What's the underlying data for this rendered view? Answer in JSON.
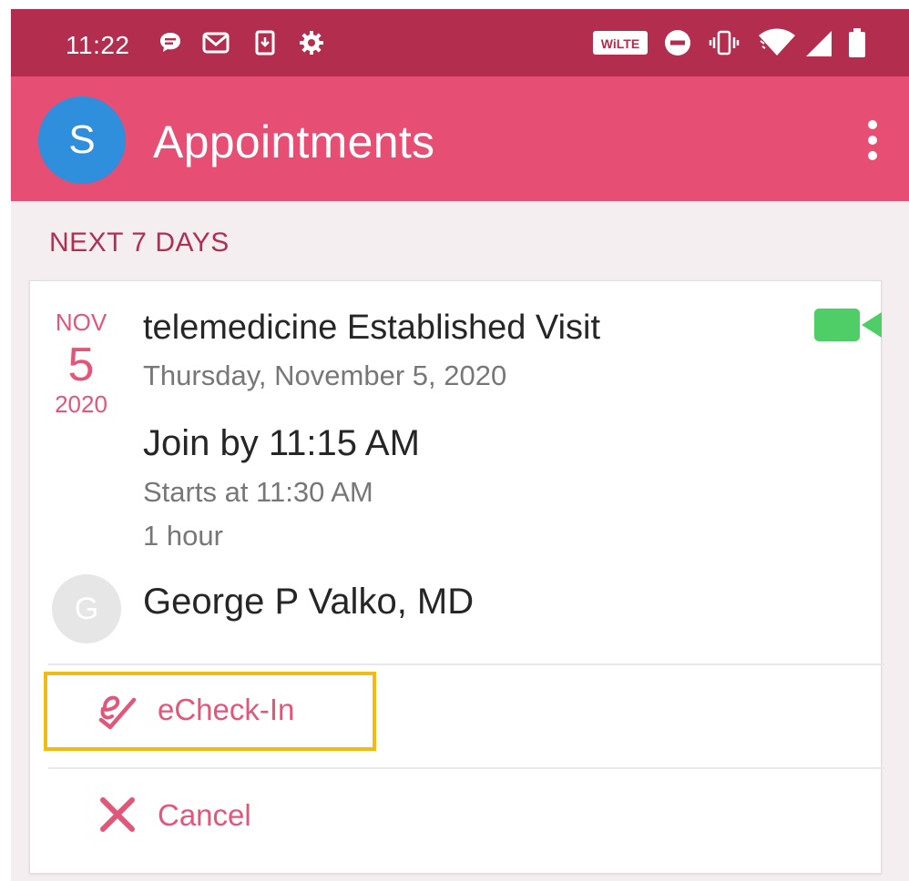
{
  "status_bar": {
    "time": "11:22",
    "left_icons": [
      "chat-bubble-icon",
      "gmail-icon",
      "download-icon",
      "settings-icon"
    ],
    "right_icons": [
      "volte-icon",
      "do-not-disturb-icon",
      "vibrate-icon",
      "wifi-icon",
      "signal-icon",
      "battery-icon"
    ],
    "volte_label": "WiLTE",
    "bg_color": "#b22d4e"
  },
  "app_bar": {
    "avatar_initial": "S",
    "title": "Appointments",
    "bg_color": "#e64e74",
    "avatar_color": "#2f8fdd"
  },
  "section": {
    "header": "NEXT 7 DAYS"
  },
  "appointment": {
    "month": "NOV",
    "day": "5",
    "year": "2020",
    "title": "telemedicine Established Visit",
    "date_full": "Thursday, November 5, 2020",
    "join_by": "Join by 11:15 AM",
    "starts_at": "Starts at 11:30 AM",
    "duration": "1 hour",
    "provider_initial": "G",
    "provider_name": "George P Valko, MD",
    "video_icon_color": "#4fce68"
  },
  "actions": {
    "echeckin_label": "eCheck-In",
    "cancel_label": "Cancel",
    "accent_color": "#e2567a",
    "highlight_color": "#f2bb11"
  }
}
